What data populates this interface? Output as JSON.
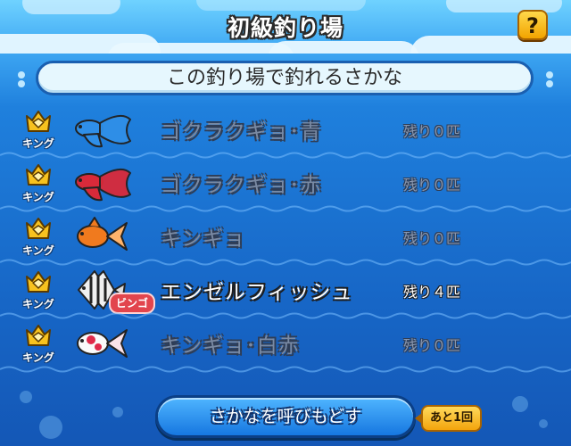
{
  "header": {
    "title": "初級釣り場",
    "help_label": "?"
  },
  "subheader": {
    "text": "この釣り場で釣れるさかな"
  },
  "fish": [
    {
      "name": "ゴクラクギョ･青",
      "remaining": "残り０匹",
      "rank": "キング",
      "icon": "blue-betta-fish-icon",
      "color": "#2f8fe8",
      "active": false,
      "bingo": ""
    },
    {
      "name": "ゴクラクギョ･赤",
      "remaining": "残り０匹",
      "rank": "キング",
      "icon": "red-betta-fish-icon",
      "color": "#d92a3a",
      "active": false,
      "bingo": ""
    },
    {
      "name": "キンギョ",
      "remaining": "残り０匹",
      "rank": "キング",
      "icon": "goldfish-icon",
      "color": "#f07a1e",
      "active": false,
      "bingo": ""
    },
    {
      "name": "エンゼルフィッシュ",
      "remaining": "残り４匹",
      "rank": "キング",
      "icon": "angelfish-icon",
      "color": "#e8e8e8",
      "active": true,
      "bingo": "ビンゴ"
    },
    {
      "name": "キンギョ･白赤",
      "remaining": "残り０匹",
      "rank": "キング",
      "icon": "white-red-goldfish-icon",
      "color": "#f5f5f5",
      "active": false,
      "bingo": ""
    }
  ],
  "bottom": {
    "button_label": "さかなを呼びもどす",
    "remaining_uses": "あと1回"
  },
  "colors": {
    "sea_top": "#3ea7f3",
    "sea_bottom": "#1457b6",
    "crown": "#f7c21f",
    "button_blue": "#1677e0",
    "accent_yellow": "#f3a40c",
    "bingo_red": "#e2454d"
  }
}
